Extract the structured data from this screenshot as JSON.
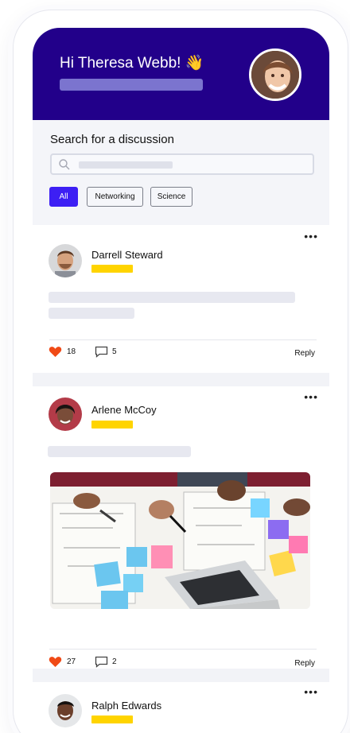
{
  "header": {
    "greeting": "Hi Theresa Webb! 👋"
  },
  "search": {
    "title": "Search for a discussion",
    "filters": [
      "All",
      "Networking",
      "Science"
    ],
    "active_filter": "All"
  },
  "posts": [
    {
      "author": "Darrell Steward",
      "likes": "18",
      "comments": "5",
      "reply": "Reply"
    },
    {
      "author": "Arlene McCoy",
      "likes": "27",
      "comments": "2",
      "reply": "Reply"
    },
    {
      "author": "Ralph Edwards"
    }
  ],
  "icons": {
    "more": "more-icon",
    "heart": "heart-icon",
    "comment": "comment-icon",
    "search": "search-icon",
    "wave": "wave-emoji"
  },
  "colors": {
    "header_bg": "#22008a",
    "accent": "#3d1ff4",
    "highlight": "#ffd400",
    "heart": "#f04a16"
  }
}
